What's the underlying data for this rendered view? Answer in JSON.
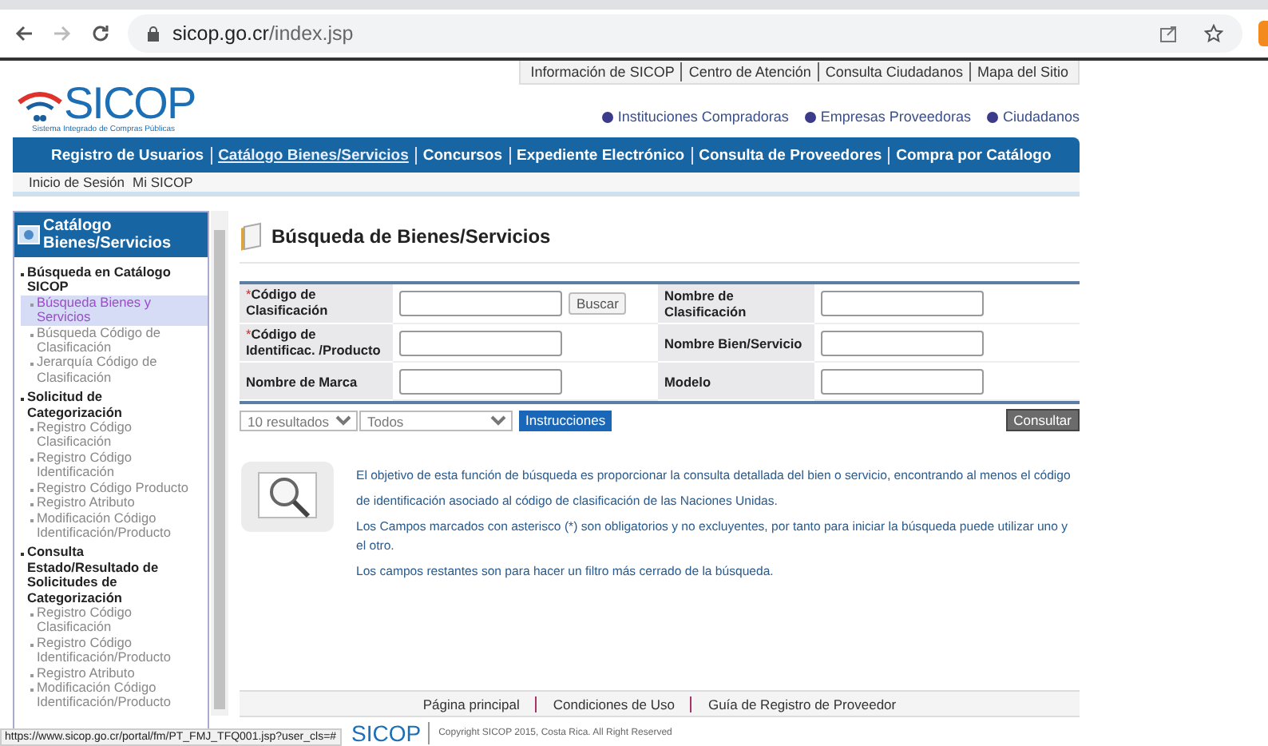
{
  "browser": {
    "url_host": "sicop.go.cr",
    "url_path": "/index.jsp"
  },
  "top_links": [
    "Información de SICOP",
    "Centro de Atención",
    "Consulta Ciudadanos",
    "Mapa del Sitio"
  ],
  "logo": {
    "name": "SICOP",
    "tagline": "Sistema Integrado de Compras Públicas"
  },
  "audience_links": [
    "Instituciones Compradoras",
    "Empresas Proveedoras",
    "Ciudadanos"
  ],
  "main_nav": [
    {
      "label": "Registro de Usuarios",
      "selected": false
    },
    {
      "label": "Catálogo Bienes/Servicios",
      "selected": true
    },
    {
      "label": "Concursos",
      "selected": false
    },
    {
      "label": "Expediente Electrónico",
      "selected": false
    },
    {
      "label": "Consulta de Proveedores",
      "selected": false
    },
    {
      "label": "Compra por Catálogo",
      "selected": false
    }
  ],
  "sub_nav": [
    "Inicio de Sesión",
    "Mi SICOP"
  ],
  "sidebar": {
    "title": "Catálogo Bienes/Servicios",
    "sections": [
      {
        "label": "Búsqueda en Catálogo SICOP",
        "children": [
          {
            "label": "Búsqueda Bienes y Servicios",
            "selected": true
          },
          {
            "label": "Búsqueda Código de Clasificación",
            "selected": false
          },
          {
            "label": "Jerarquía Código de Clasificación",
            "selected": false
          }
        ]
      },
      {
        "label": "Solicitud de Categorización",
        "children": [
          {
            "label": "Registro Código Clasificación",
            "selected": false
          },
          {
            "label": "Registro Código Identificación",
            "selected": false
          },
          {
            "label": "Registro Código Producto",
            "selected": false
          },
          {
            "label": "Registro Atributo",
            "selected": false
          },
          {
            "label": "Modificación Código Identificación/Producto",
            "selected": false
          }
        ]
      },
      {
        "label": "Consulta Estado/Resultado de Solicitudes de Categorización",
        "children": [
          {
            "label": "Registro Código Clasificación",
            "selected": false
          },
          {
            "label": "Registro Código Identificación/Producto",
            "selected": false
          },
          {
            "label": "Registro Atributo",
            "selected": false
          },
          {
            "label": "Modificación Código Identificación/Producto",
            "selected": false
          }
        ]
      }
    ]
  },
  "page_title": "Búsqueda de Bienes/Servicios",
  "required_mark": "*",
  "form_rows": [
    {
      "left": {
        "label": "Código de Clasificación",
        "required": true,
        "button": "Buscar"
      },
      "right": {
        "label": "Nombre de Clasificación",
        "required": false
      }
    },
    {
      "left": {
        "label": "Código de Identificac. /Producto",
        "required": true
      },
      "right": {
        "label": "Nombre Bien/Servicio",
        "required": false
      }
    },
    {
      "left": {
        "label": "Nombre de Marca",
        "required": false
      },
      "right": {
        "label": "Modelo",
        "required": false
      }
    }
  ],
  "results_select": "10 resultados",
  "filter_select": "Todos",
  "instructions_button": "Instrucciones",
  "submit_button": "Consultar",
  "info": [
    "El objetivo de esta función de búsqueda es proporcionar la consulta detallada del bien o servicio, encontrando al menos el código",
    "de identificación asociado al código de clasificación de las Naciones Unidas.",
    "Los Campos marcados con asterisco (*) son obligatorios y no excluyentes, por tanto para iniciar la búsqueda puede utilizar uno y el otro.",
    "Los campos restantes son para hacer un filtro más cerrado de la búsqueda."
  ],
  "footer_links": [
    "Página principal",
    "Condiciones de Uso",
    "Guía de Registro de Proveedor"
  ],
  "footer_logo": "SICOP",
  "copyright": "Copyright SICOP 2015, Costa Rica. All Right Reserved",
  "status_url": "https://www.sicop.go.cr/portal/fm/PT_FMJ_TFQ001.jsp?user_cls=#"
}
